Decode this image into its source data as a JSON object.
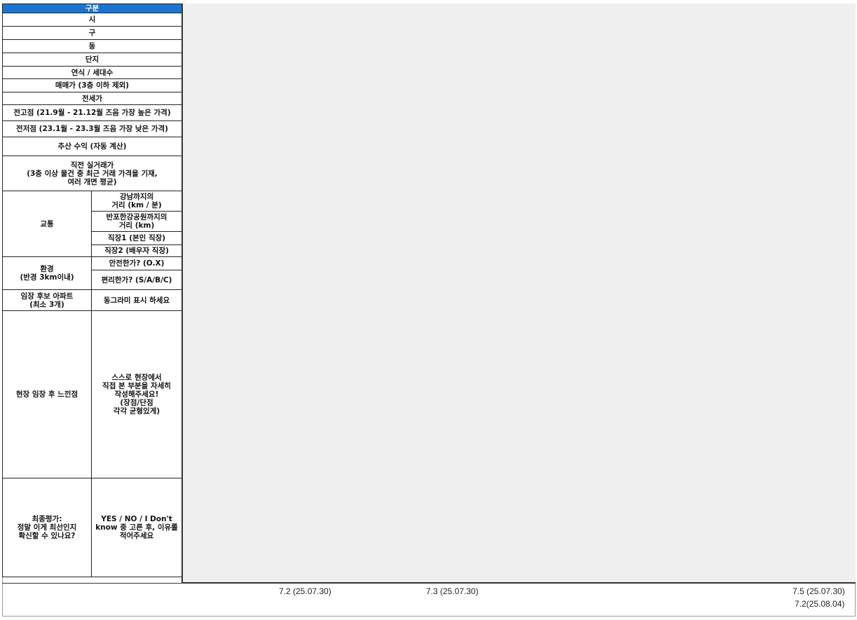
{
  "header_cell": "구분",
  "rows": {
    "si": "시",
    "gu": "구",
    "dong": "동",
    "danji": "단지",
    "year_units": "연식 / 세대수",
    "sale_price": "매매가 (3층 이하 제외)",
    "jeonse": "전세가",
    "prev_high": "전고점 (21.9월 - 21.12월 즈음 가장 높은 가격)",
    "prev_low": "전저점 (23.1월 - 23.3월 즈음 가장 낮은 가격)",
    "est_return": "추산 수익 (자동 계산)",
    "recent_trade_l1": "직전 실거래가",
    "recent_trade_l2": "(3층 이상 물건 중 최근 거래 가격을 기재,",
    "recent_trade_l3": "여러 개면 평균)"
  },
  "transport": {
    "label": "교통",
    "gangnam_l1": "강남까지의",
    "gangnam_l2": "거리 (km / 분)",
    "banpo_l1": "반포한강공원까지의",
    "banpo_l2": "거리 (km)",
    "work1": "직장1 (본인 직장)",
    "work2": "직장2 (배우자 직장)"
  },
  "environment": {
    "label_l1": "환경",
    "label_l2": "(반경 3km이내)",
    "safe": "안전한가? (O.X)",
    "convenient": "편리한가? (S/A/B/C)"
  },
  "candidate": {
    "label_l1": "임장 후보 아파트",
    "label_l2": "(최소 3개)",
    "hint": "동그라미 표시 하세요"
  },
  "impression": {
    "label": "현장 임장 후 느낀점",
    "hint_l1": "스스로 현장에서",
    "hint_l2": "직접 본 부분을 자세히",
    "hint_l3": "작성해주세요!",
    "hint_l4": "(장점/단점",
    "hint_l5": "각각 균형있게)"
  },
  "final": {
    "label_l1": "최종평가:",
    "label_l2": "정말 이게 최선인지",
    "label_l3": "확신할 수 있나요?",
    "hint_l1": "YES / NO / I Don't",
    "hint_l2": "know 중 고른 후, 이유를",
    "hint_l3": "적어주세요"
  },
  "footer_versions": {
    "v1": "7.2 (25.07.30)",
    "v2": "7.3 (25.07.30)",
    "v3": "7.5 (25.07.30)",
    "v4": "7.2(25.08.04)"
  },
  "colors": {
    "header_blue": "#1b75d0",
    "grid_grey": "#efefef"
  }
}
